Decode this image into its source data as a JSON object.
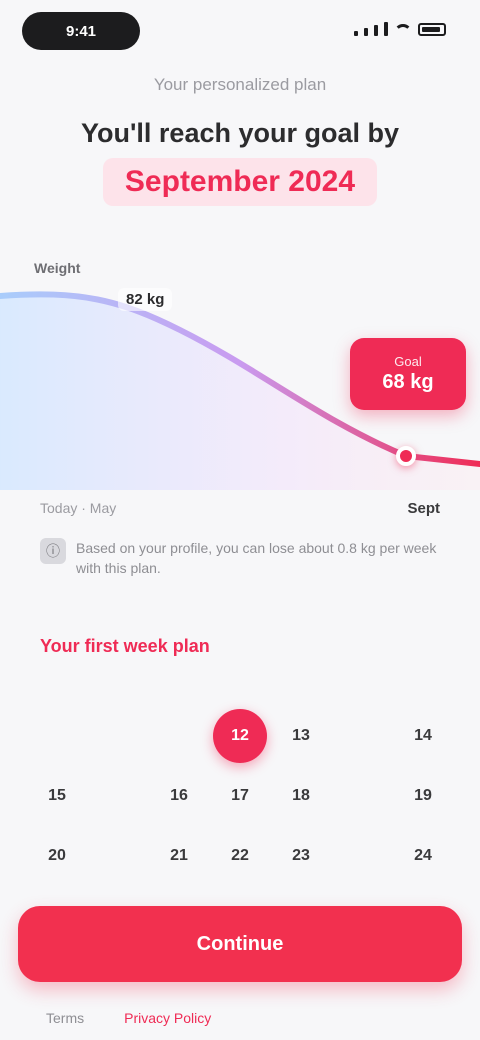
{
  "status_bar": {
    "time": "9:41"
  },
  "header": {
    "subtitle": "Your personalized plan",
    "title": "You'll reach your goal by",
    "highlight": "September 2024"
  },
  "chart": {
    "y_label": "Weight",
    "start_value": "82 kg",
    "goal_label": "Goal",
    "goal_value": "68 kg",
    "x_start": "Today · May",
    "x_end": "Sept"
  },
  "note": {
    "icon": "info-icon",
    "text": "Based on your profile, you can lose about 0.8 kg per week with this plan."
  },
  "calendar": {
    "title": "Your first week plan",
    "rows": [
      [
        "",
        "",
        "",
        "12",
        "13",
        "",
        "14"
      ],
      [
        "15",
        "",
        "16",
        "17",
        "18",
        "",
        "19"
      ],
      [
        "20",
        "",
        "21",
        "22",
        "23",
        "",
        "24"
      ]
    ],
    "selected": "12"
  },
  "cta": {
    "label": "Continue"
  },
  "footer": {
    "left": "Terms",
    "right": "Privacy Policy"
  },
  "colors": {
    "accent": "#ef2b55",
    "background": "#f7f7f9"
  }
}
